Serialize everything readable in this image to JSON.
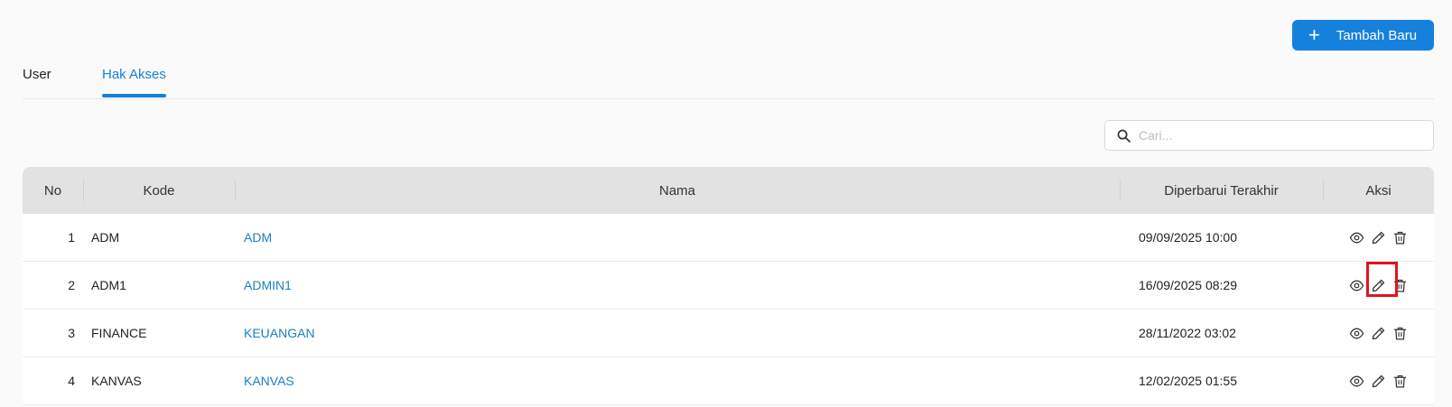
{
  "toolbar": {
    "add_label": "Tambah Baru"
  },
  "tabs": [
    {
      "label": "User",
      "active": false
    },
    {
      "label": "Hak Akses",
      "active": true
    }
  ],
  "search": {
    "placeholder": "Cari..."
  },
  "table": {
    "headers": {
      "no": "No",
      "kode": "Kode",
      "nama": "Nama",
      "updated": "Diperbarui Terakhir",
      "aksi": "Aksi"
    },
    "rows": [
      {
        "no": "1",
        "kode": "ADM",
        "nama": "ADM",
        "updated": "09/09/2025 10:00"
      },
      {
        "no": "2",
        "kode": "ADM1",
        "nama": "ADMIN1",
        "updated": "16/09/2025 08:29"
      },
      {
        "no": "3",
        "kode": "FINANCE",
        "nama": "KEUANGAN",
        "updated": "28/11/2022 03:02"
      },
      {
        "no": "4",
        "kode": "KANVAS",
        "nama": "KANVAS",
        "updated": "12/02/2025 01:55"
      }
    ]
  },
  "colors": {
    "accent": "#1681dd",
    "link": "#1a7fc1",
    "highlight": "#e0141e"
  },
  "icons": {
    "view": "eye-icon",
    "edit": "pencil-icon",
    "delete": "trash-icon",
    "search": "search-icon",
    "add": "plus-icon"
  }
}
